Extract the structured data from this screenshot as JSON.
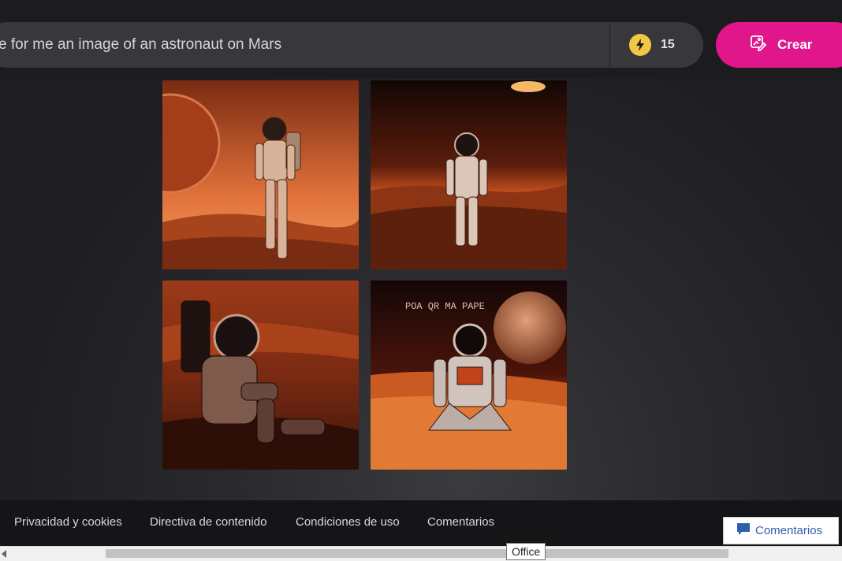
{
  "prompt": {
    "value": "e for me an image of an astronaut on Mars"
  },
  "boosts": {
    "count": "15",
    "icon": "boost-bolt-icon"
  },
  "create_button": {
    "label": "Crear",
    "icon": "create-image-icon"
  },
  "images": [
    {
      "caption": "",
      "alt": "astronaut-on-mars-1"
    },
    {
      "caption": "",
      "alt": "astronaut-on-mars-2"
    },
    {
      "caption": "",
      "alt": "astronaut-on-mars-3"
    },
    {
      "caption": "POA QR MA PAPE",
      "alt": "astronaut-on-mars-4"
    }
  ],
  "footer": {
    "links": [
      "Privacidad y cookies",
      "Directiva de contenido",
      "Condiciones de uso",
      "Comentarios"
    ]
  },
  "feedback_button": {
    "label": "Comentarios",
    "icon": "chat-bubble-icon"
  },
  "tooltip": {
    "text": "Office"
  },
  "colors": {
    "accent": "#e0168a",
    "boost": "#f2c744",
    "background": "#2a2a2e",
    "link": "#2e5fa8"
  }
}
